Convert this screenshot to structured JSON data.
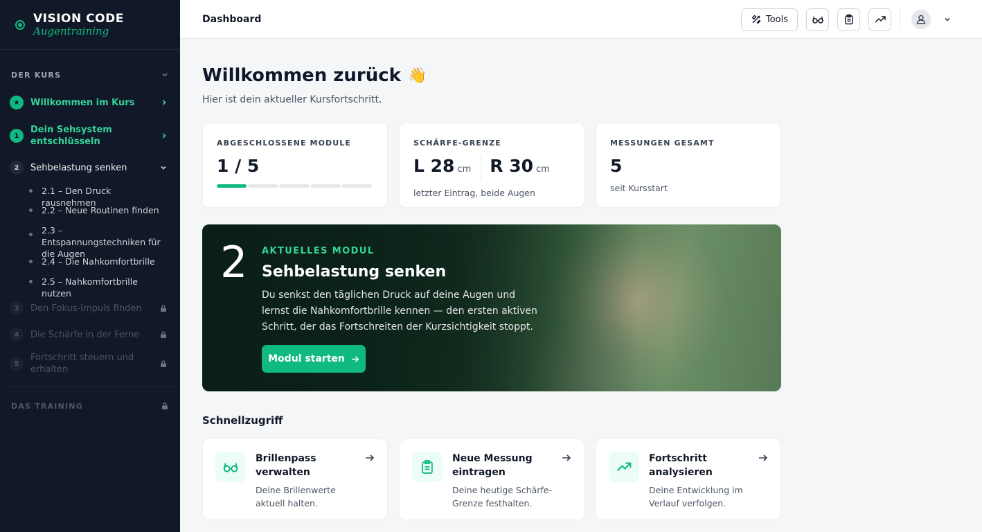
{
  "brand": {
    "title": "VISION CODE",
    "subtitle": "Augentraining"
  },
  "sidebar": {
    "course_section": "DER KURS",
    "items": [
      {
        "num": "★",
        "label": "Willkommen im Kurs"
      },
      {
        "num": "1",
        "label": "Dein Sehsystem entschlüsseln"
      },
      {
        "num": "2",
        "label": "Sehbelastung senken"
      },
      {
        "num": "3",
        "label": "Den Fokus-Impuls finden"
      },
      {
        "num": "4",
        "label": "Die Schärfe in der Ferne"
      },
      {
        "num": "5",
        "label": "Fortschritt steuern und erhalten"
      }
    ],
    "subitems": [
      "2.1 – Den Druck rausnehmen",
      "2.2 – Neue Routinen finden",
      "2.3 – Entspannungstechniken für die Augen",
      "2.4 – Die Nahkomfortbrille",
      "2.5 – Nahkomfortbrille nutzen"
    ],
    "training_section": "DAS TRAINING"
  },
  "topbar": {
    "title": "Dashboard",
    "tools_label": "Tools"
  },
  "welcome": {
    "title": "Willkommen zurück",
    "emoji": "👋",
    "subtitle": "Hier ist dein aktueller Kursfortschritt."
  },
  "stats": {
    "modules": {
      "label": "ABGESCHLOSSENE MODULE",
      "value": "1 / 5",
      "completed": 1,
      "total": 5
    },
    "sharpness": {
      "label": "SCHÄRFE-GRENZE",
      "left": "L 28",
      "right": "R 30",
      "unit": "cm",
      "note": "letzter Eintrag, beide Augen"
    },
    "measurements": {
      "label": "MESSUNGEN GESAMT",
      "value": "5",
      "note": "seit Kursstart"
    }
  },
  "hero": {
    "number": "2",
    "kicker": "AKTUELLES MODUL",
    "title": "Sehbelastung senken",
    "text": "Du senkst den täglichen Druck auf deine Augen und lernst die Nahkomfortbrille kennen — den ersten aktiven Schritt, der das Fortschreiten der Kurzsichtigkeit stoppt.",
    "button": "Modul starten"
  },
  "quick": {
    "title": "Schnellzugriff",
    "cards": [
      {
        "icon": "glasses-icon",
        "title": "Brillenpass verwalten",
        "desc": "Deine Brillenwerte aktuell halten."
      },
      {
        "icon": "clipboard-icon",
        "title": "Neue Messung eintragen",
        "desc": "Deine heutige Schärfe-Grenze festhalten."
      },
      {
        "icon": "trend-icon",
        "title": "Fortschritt analysieren",
        "desc": "Deine Entwicklung im Verlauf verfolgen."
      }
    ]
  },
  "colors": {
    "accent": "#10b981",
    "sidebar_bg": "#111827"
  }
}
